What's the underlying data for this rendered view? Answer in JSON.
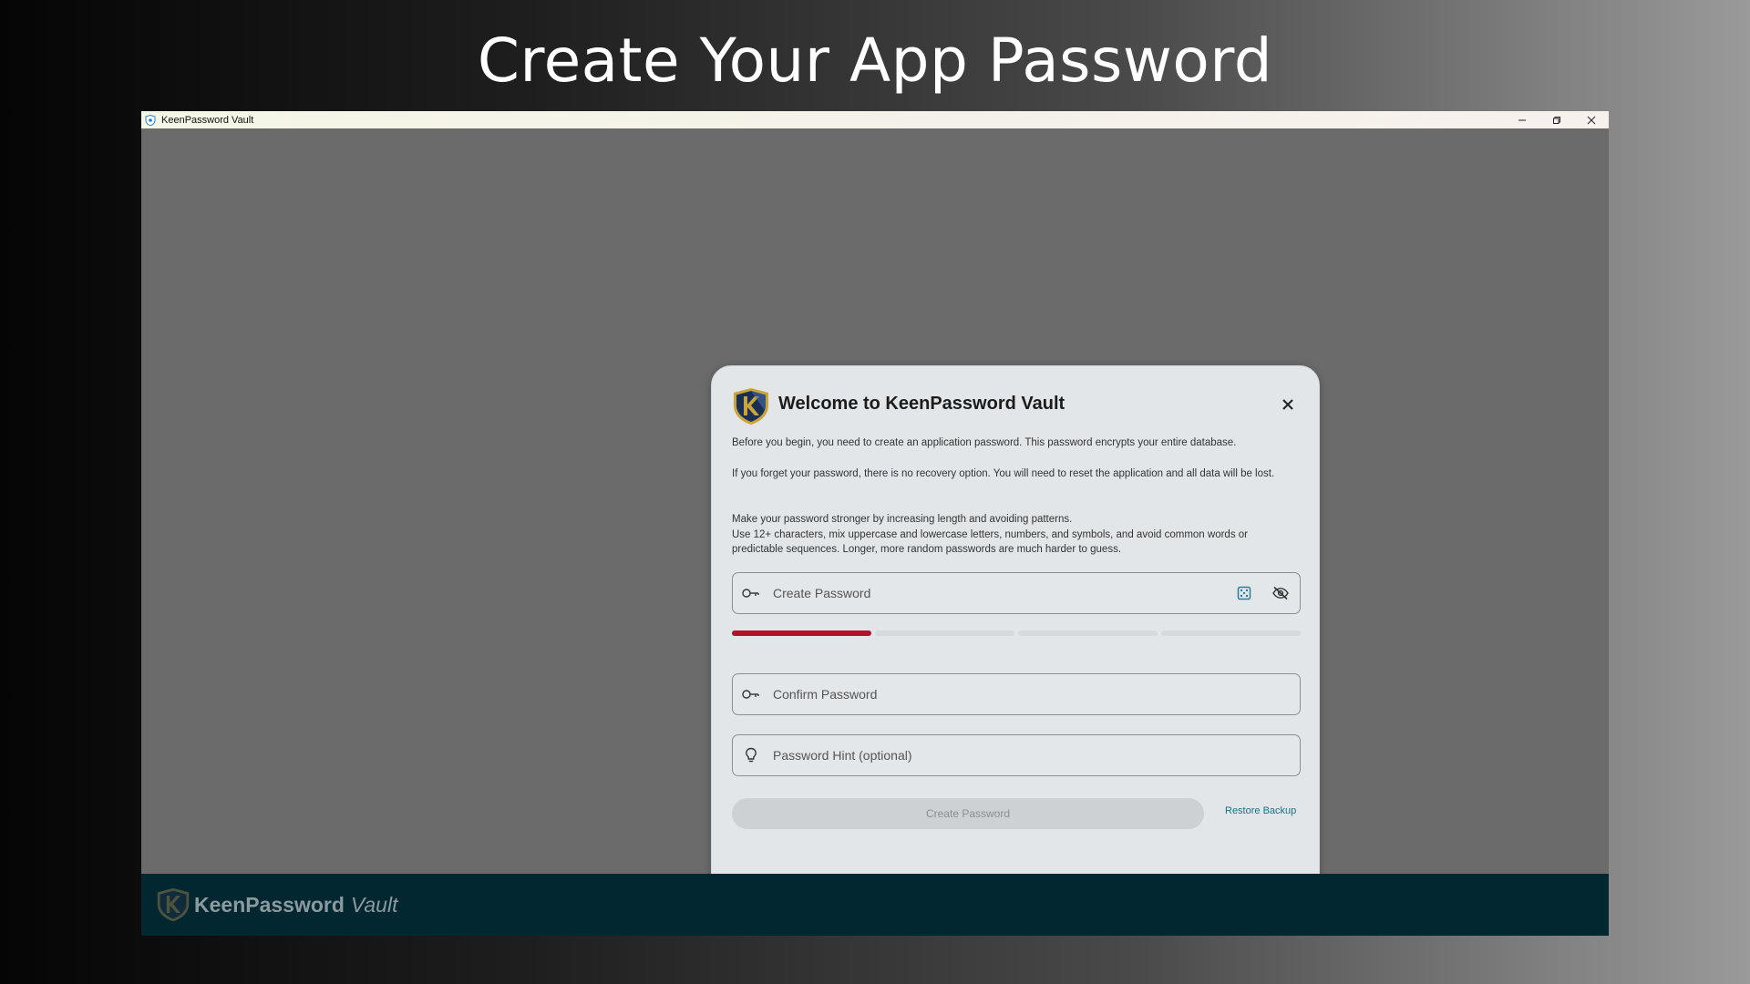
{
  "headline": "Create Your App Password",
  "window": {
    "title": "KeenPassword Vault",
    "controls": {
      "minimize": "–",
      "restore": "❐",
      "close": "✕"
    }
  },
  "dialog": {
    "title": "Welcome to KeenPassword Vault",
    "paragraphs": [
      "Before you begin, you need to create an application password. This password encrypts your entire database.",
      "If you forget your password, there is no recovery option. You will need to reset the application and all data will be lost.",
      "Make your password stronger by increasing length and avoiding patterns.",
      "Use 12+ characters, mix uppercase and lowercase letters, numbers, and symbols, and avoid common words or predictable sequences. Longer, more random passwords are much harder to guess."
    ],
    "fields": {
      "create": {
        "placeholder": "Create Password",
        "value": ""
      },
      "confirm": {
        "placeholder": "Confirm Password",
        "value": ""
      },
      "hint": {
        "placeholder": "Password Hint (optional)",
        "value": ""
      }
    },
    "strength": {
      "filled_segments": 1,
      "total_segments": 4,
      "color": "#b2102b"
    },
    "buttons": {
      "create": "Create Password",
      "restore": "Restore Backup"
    }
  },
  "footer": {
    "brand": "KeenPassword",
    "brand_suffix": "Vault"
  },
  "icons": {
    "app": "shield-logo-icon",
    "key": "key-icon",
    "dice": "dice-icon",
    "eye_off": "eye-off-icon",
    "bulb": "lightbulb-icon",
    "close": "close-icon"
  },
  "colors": {
    "footer_bg": "#032730",
    "accent_link": "#1f6f86",
    "dice_accent": "#2a7e96",
    "logo_gold": "#c9a43a",
    "logo_navy": "#1b2f55"
  }
}
